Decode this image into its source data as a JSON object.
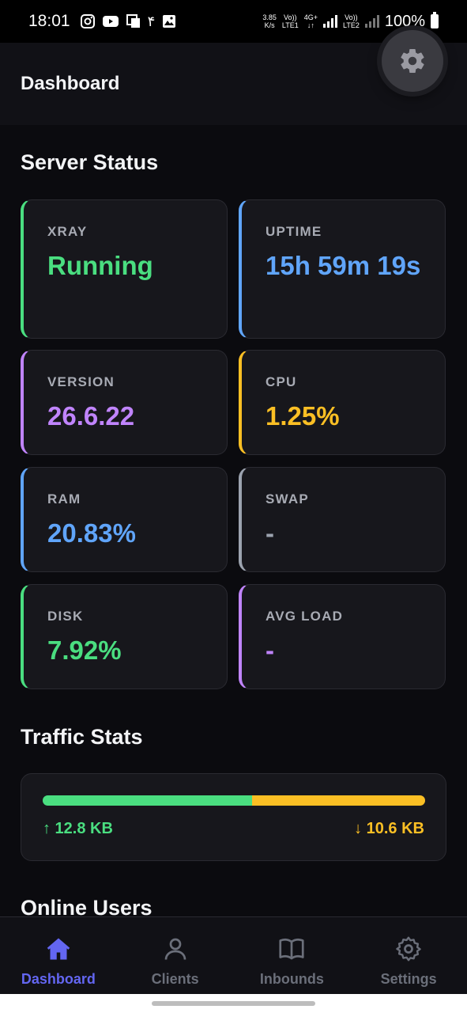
{
  "status_bar": {
    "time": "18:01",
    "persian_digit": "۴",
    "net_speed_value": "3.85",
    "net_speed_unit": "K/s",
    "sim1_top": "Vo))",
    "sim1_bottom": "LTE1",
    "net_type_top": "4G+",
    "net_type_bottom": "↓↑",
    "sim2_top": "Vo))",
    "sim2_bottom": "LTE2",
    "battery": "100%"
  },
  "app_bar": {
    "title": "Dashboard"
  },
  "server_status": {
    "title": "Server Status",
    "cards": [
      {
        "label": "XRAY",
        "value": "Running",
        "color": "#4ade80"
      },
      {
        "label": "UPTIME",
        "value": "15h 59m 19s",
        "color": "#60a5fa"
      },
      {
        "label": "VERSION",
        "value": "26.6.22",
        "color": "#c084fc"
      },
      {
        "label": "CPU",
        "value": "1.25%",
        "color": "#fbbf24"
      },
      {
        "label": "RAM",
        "value": "20.83%",
        "color": "#60a5fa"
      },
      {
        "label": "SWAP",
        "value": "-",
        "color": "#9ca3af"
      },
      {
        "label": "DISK",
        "value": "7.92%",
        "color": "#4ade80"
      },
      {
        "label": "AVG LOAD",
        "value": "-",
        "color": "#c084fc"
      }
    ]
  },
  "traffic": {
    "title": "Traffic Stats",
    "upload": "↑ 12.8 KB",
    "download": "↓ 10.6 KB",
    "upload_fraction": 0.547,
    "upload_color": "#4ade80",
    "download_color": "#fbbf24"
  },
  "online_users": {
    "title": "Online Users"
  },
  "bottom_nav": {
    "active_color": "#6366f1",
    "items": [
      {
        "label": "Dashboard",
        "icon": "home-icon"
      },
      {
        "label": "Clients",
        "icon": "user-icon"
      },
      {
        "label": "Inbounds",
        "icon": "book-icon"
      },
      {
        "label": "Settings",
        "icon": "gear-icon"
      }
    ]
  }
}
